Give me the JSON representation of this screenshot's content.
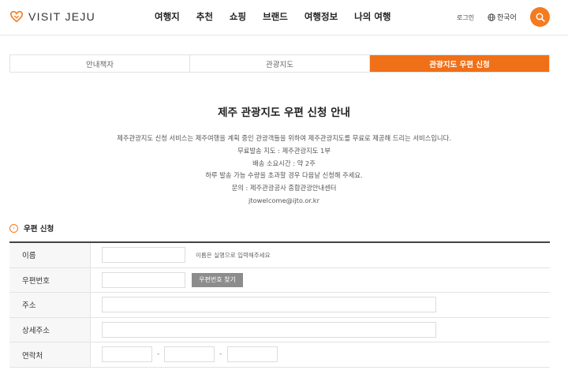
{
  "header": {
    "logo_text": "VISIT JEJU",
    "nav": [
      "여행지",
      "추천",
      "쇼핑",
      "브랜드",
      "여행정보",
      "나의 여행"
    ],
    "login": "로그인",
    "language": "한국어",
    "accent_color": "#f47b20"
  },
  "tabs": [
    {
      "label": "안내책자",
      "active": false
    },
    {
      "label": "관광지도",
      "active": false
    },
    {
      "label": "관광지도 우편 신청",
      "active": true
    }
  ],
  "intro": {
    "title": "제주 관광지도 우편 신청 안내",
    "lines": [
      "제주관광지도 신청 서비스는 제주여행을 계획 중인 관광객들을 위하여 제주관광지도를 무료로 제공해 드리는 서비스입니다.",
      "무료발송 지도 : 제주관광지도 1부",
      "배송 소요시간 : 약 2주",
      "하루 발송 가능 수량을 초과할 경우 다음날 신청해 주세요.",
      "문의 : 제주관광공사 종합관광안내센터",
      "jtowelcome@ijto.or.kr"
    ]
  },
  "form": {
    "section_title": "우편 신청",
    "labels": {
      "name": "이름",
      "zipcode": "우편번호",
      "address": "주소",
      "address_detail": "상세주소",
      "phone": "연락처"
    },
    "name_hint": "이름은 실명으로 입력해주세요",
    "zip_button": "우편번호 찾기",
    "phone_separator": "-"
  }
}
